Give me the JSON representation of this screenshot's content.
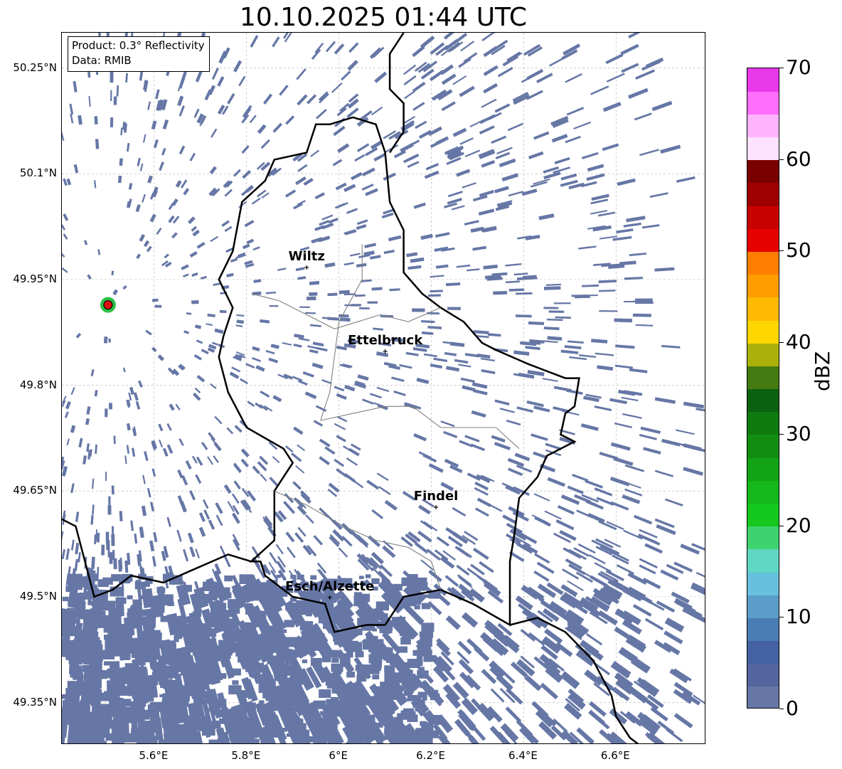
{
  "title": "10.10.2025 01:44 UTC",
  "info_box": {
    "product": "Product: 0.3° Reflectivity",
    "data": "Data: RMIB"
  },
  "map": {
    "extent": {
      "lon_min": 5.4,
      "lon_max": 6.795,
      "lat_min": 49.29,
      "lat_max": 50.3
    },
    "lat_ticks": [
      {
        "value": 50.25,
        "label": "50.25°N"
      },
      {
        "value": 50.1,
        "label": "50.1°N"
      },
      {
        "value": 49.95,
        "label": "49.95°N"
      },
      {
        "value": 49.8,
        "label": "49.8°N"
      },
      {
        "value": 49.65,
        "label": "49.65°N"
      },
      {
        "value": 49.5,
        "label": "49.5°N"
      },
      {
        "value": 49.35,
        "label": "49.35°N"
      }
    ],
    "lon_ticks": [
      {
        "value": 5.6,
        "label": "5.6°E"
      },
      {
        "value": 5.8,
        "label": "5.8°E"
      },
      {
        "value": 6.0,
        "label": "6°E"
      },
      {
        "value": 6.2,
        "label": "6.2°E"
      },
      {
        "value": 6.4,
        "label": "6.4°E"
      },
      {
        "value": 6.6,
        "label": "6.6°E"
      }
    ],
    "radar_site": {
      "lon": 5.5,
      "lat": 49.914
    },
    "cities": [
      {
        "name": "Wiltz",
        "lon": 5.93,
        "lat": 49.967
      },
      {
        "name": "Ettelbruck",
        "lon": 6.1,
        "lat": 49.848
      },
      {
        "name": "Findel",
        "lon": 6.21,
        "lat": 49.627
      },
      {
        "name": "Esch/Alzette",
        "lon": 5.98,
        "lat": 49.499
      }
    ],
    "echo_color": "#6677a6",
    "border_color": "#000000",
    "canton_color": "#808080"
  },
  "colorbar": {
    "label": "dBZ",
    "min": 0,
    "max": 70,
    "step": 2.5,
    "ticks": [
      {
        "value": 0,
        "label": "0"
      },
      {
        "value": 10,
        "label": "10"
      },
      {
        "value": 20,
        "label": "20"
      },
      {
        "value": 30,
        "label": "30"
      },
      {
        "value": 40,
        "label": "40"
      },
      {
        "value": 50,
        "label": "50"
      },
      {
        "value": 60,
        "label": "60"
      },
      {
        "value": 70,
        "label": "70"
      }
    ],
    "colors": [
      "#6677a6",
      "#53659d",
      "#4462a3",
      "#4b7db5",
      "#5b9dc8",
      "#67c0dd",
      "#5fd7c4",
      "#3fd36f",
      "#14c81e",
      "#14b81a",
      "#12a414",
      "#118e12",
      "#0f7a10",
      "#0a6110",
      "#457a10",
      "#acb10a",
      "#ffd600",
      "#ffb900",
      "#ff9c00",
      "#ff7e00",
      "#e60000",
      "#c80000",
      "#9e0000",
      "#7a0000",
      "#ffe2ff",
      "#ffb4ff",
      "#ff6efc",
      "#e838ea"
    ]
  }
}
